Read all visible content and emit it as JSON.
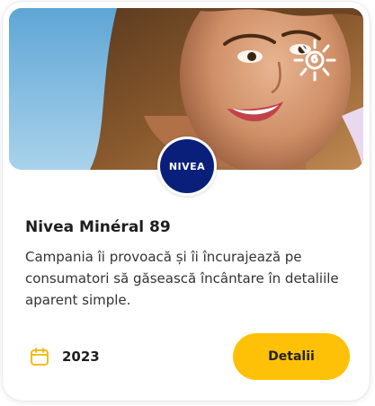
{
  "card": {
    "title": "Nivea Minéral 89",
    "description": "Campania îi provoacă și îi încurajează pe consumatori să găsească încântare în detaliile aparent simple.",
    "year": "2023",
    "details_label": "Detalii",
    "brand_logo_text": "NIVEA"
  },
  "icons": {
    "calendar": "calendar-icon"
  },
  "colors": {
    "accent": "#ffc107",
    "calendar_icon": "#f4b400",
    "brand": "#0a1f7a",
    "title_text": "#1e1e1e",
    "body_text": "#333333"
  }
}
